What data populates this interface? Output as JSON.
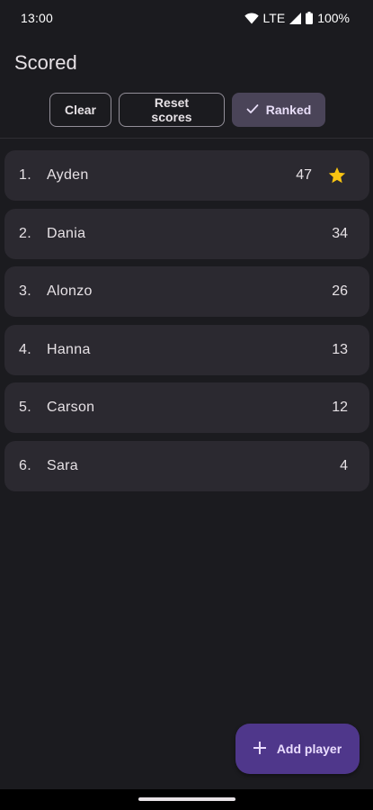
{
  "status_bar": {
    "time": "13:00",
    "network": "LTE",
    "battery": "100%"
  },
  "app_bar": {
    "title": "Scored"
  },
  "chips": {
    "clear": "Clear",
    "reset": "Reset scores",
    "ranked": "Ranked"
  },
  "players": [
    {
      "rank": "1.",
      "name": "Ayden",
      "score": "47"
    },
    {
      "rank": "2.",
      "name": "Dania",
      "score": "34"
    },
    {
      "rank": "3.",
      "name": "Alonzo",
      "score": "26"
    },
    {
      "rank": "4.",
      "name": "Hanna",
      "score": "13"
    },
    {
      "rank": "5.",
      "name": "Carson",
      "score": "12"
    },
    {
      "rank": "6.",
      "name": "Sara",
      "score": "4"
    }
  ],
  "fab": {
    "label": "Add player"
  },
  "colors": {
    "background": "#1b1b1f",
    "row_background": "#2b2930",
    "accent": "#4f378b",
    "star": "#f9c412"
  },
  "icons": {
    "leader": "star-icon",
    "fab": "plus-icon",
    "ranked_chip": "check-icon"
  }
}
